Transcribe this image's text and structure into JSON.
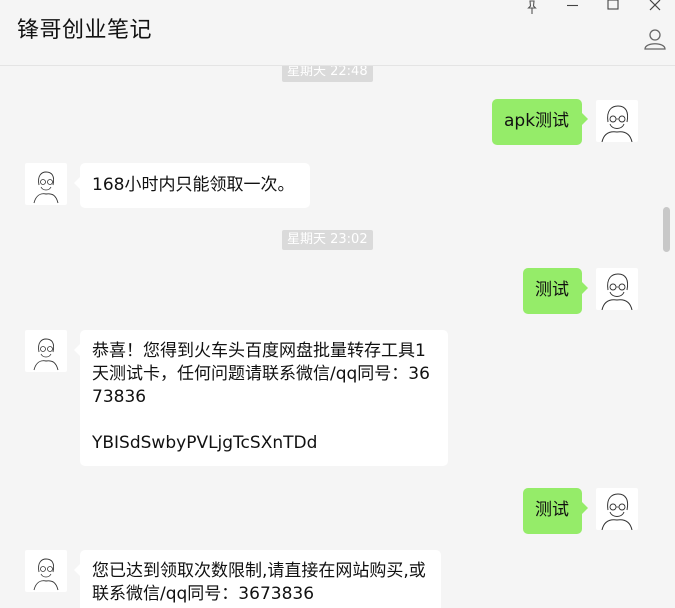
{
  "window": {
    "title": "锋哥创业笔记"
  },
  "chat": {
    "timestamps": [
      "星期天 22:48",
      "星期天 23:02"
    ],
    "messages": [
      {
        "sender": "me",
        "text": "apk测试"
      },
      {
        "sender": "other",
        "text": "168小时内只能领取一次。"
      },
      {
        "sender": "me",
        "text": "测试"
      },
      {
        "sender": "other",
        "text": "恭喜！您得到火车头百度网盘批量转存工具1天测试卡，任何问题请联系微信/qq同号：3673836\n\nYBISdSwbyPVLjgTcSXnTDd"
      },
      {
        "sender": "me",
        "text": "测试"
      },
      {
        "sender": "other",
        "text": "您已达到领取次数限制,请直接在网站购买,或联系微信/qq同号：3673836"
      }
    ]
  },
  "colors": {
    "my_bubble": "#95ec69",
    "other_bubble": "#ffffff",
    "background": "#f5f5f5",
    "timestamp_bg": "#dadada"
  },
  "icons": {
    "pin": "pin-icon",
    "minimize": "minimize-icon",
    "maximize": "maximize-icon",
    "close": "close-icon",
    "profile": "profile-icon",
    "avatar": "sketch-face-avatar"
  }
}
